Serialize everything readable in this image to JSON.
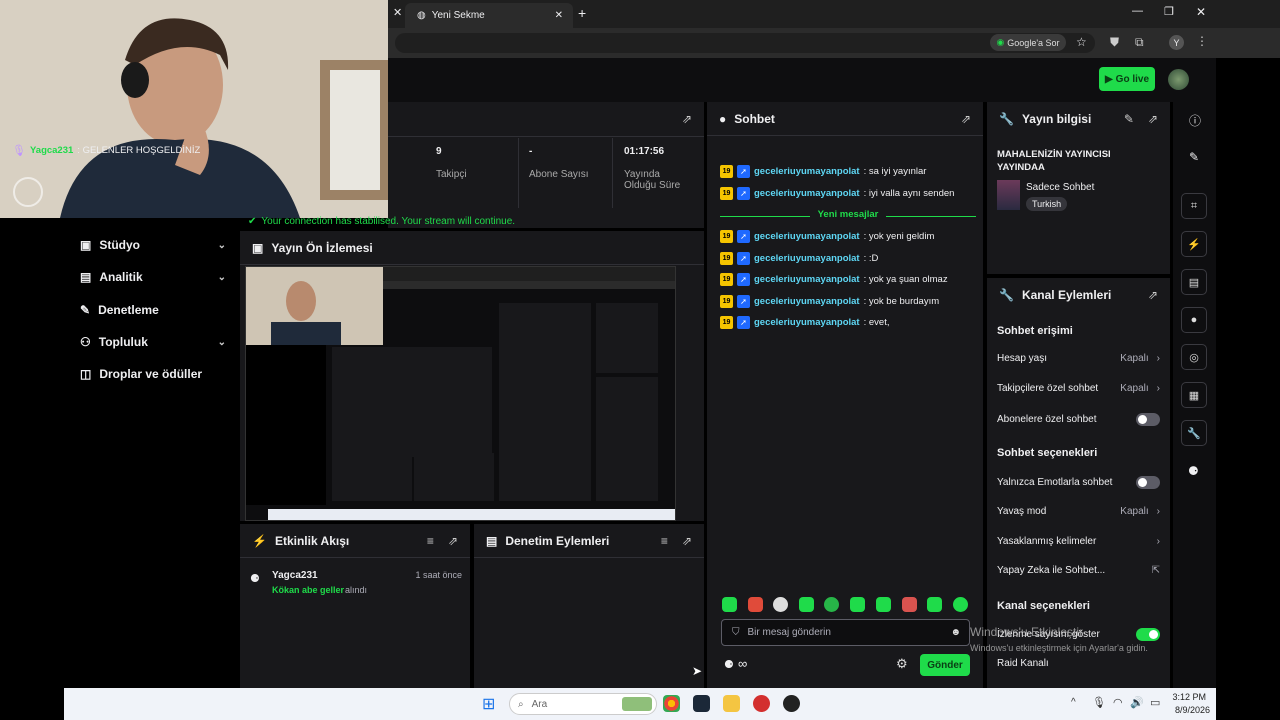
{
  "browser": {
    "tab_title": "Yeni Sekme",
    "ask_google": "Google'a Sor",
    "profile_initial": "Y"
  },
  "topnav": {
    "go_live": "Go live"
  },
  "connection_notice": "Your connection has stabilised. Your stream will continue.",
  "left_nav": {
    "items": [
      {
        "label": "Stüdyo",
        "has_chevron": true,
        "icon": "video-icon"
      },
      {
        "label": "Analitik",
        "has_chevron": true,
        "icon": "chart-icon"
      },
      {
        "label": "Denetleme",
        "has_chevron": false,
        "icon": "wrench-icon"
      },
      {
        "label": "Topluluk",
        "has_chevron": true,
        "icon": "community-icon"
      },
      {
        "label": "Droplar ve ödüller",
        "has_chevron": false,
        "icon": "gift-icon"
      }
    ]
  },
  "stats": [
    {
      "value": "9",
      "label": "Takipçi"
    },
    {
      "value": "-",
      "label": "Abone Sayısı"
    },
    {
      "value": "01:17:56",
      "label": "Yayında Olduğu Süre"
    }
  ],
  "preview": {
    "title": "Yayın Ön İzlemesi"
  },
  "activity": {
    "title": "Etkinlik Akışı",
    "items": [
      {
        "user": "Yagca231",
        "time": "1 saat önce",
        "reward": "Kökan abe geller",
        "suffix": " alındı"
      }
    ]
  },
  "mod_actions": {
    "title": "Denetim Eylemleri"
  },
  "chat": {
    "title": "Sohbet",
    "pinned": {
      "user": "Yagca231",
      "text": ": GELENLER HOŞGELDİNİZ"
    },
    "messages_before": [
      {
        "badge": "19",
        "user": "geceleriuyumayanpolat",
        "text": ": sa iyi yayınlar"
      },
      {
        "badge": "19",
        "user": "geceleriuyumayanpolat",
        "text": ": iyi valla aynı senden"
      }
    ],
    "new_messages_label": "Yeni mesajlar",
    "messages_after": [
      {
        "badge": "19",
        "user": "geceleriuyumayanpolat",
        "text": ": yok yeni geldim"
      },
      {
        "badge": "19",
        "user": "geceleriuyumayanpolat",
        "text": ": :D"
      },
      {
        "badge": "19",
        "user": "geceleriuyumayanpolat",
        "text": ": yok ya şuan olmaz"
      },
      {
        "badge": "19",
        "user": "geceleriuyumayanpolat",
        "text": ": yok be burdayım"
      },
      {
        "badge": "19",
        "user": "geceleriuyumayanpolat",
        "text": ": evet,"
      }
    ],
    "input_placeholder": "Bir mesaj gönderin",
    "send_label": "Gönder",
    "infinity": "∞"
  },
  "stream_info": {
    "title": "Yayın bilgisi",
    "stream_title": "MAHALENİZİN YAYINCISI YAYINDAA",
    "category": "Sadece Sohbet",
    "tag": "Turkish"
  },
  "channel_actions": {
    "title": "Kanal Eylemleri",
    "chat_access": "Sohbet erişimi",
    "account_age": "Hesap yaşı",
    "account_age_val": "Kapalı",
    "followers_only": "Takipçilere özel sohbet",
    "followers_only_val": "Kapalı",
    "subs_only": "Abonelere özel sohbet",
    "chat_options": "Sohbet seçenekleri",
    "emotes_only": "Yalnızca Emotlarla sohbet",
    "slow_mode": "Yavaş mod",
    "slow_mode_val": "Kapalı",
    "banned_words": "Yasaklanmış kelimeler",
    "ai_chat": "Yapay Zeka ile Sohbet...",
    "channel_options": "Kanal seçenekleri",
    "show_viewers": "İzlenme sayısını göster",
    "raid": "Raid Kanalı"
  },
  "watermark": {
    "line1": "Windows'u Etkinleştir",
    "line2": "Windows'u etkinleştirmek için Ayarlar'a gidin."
  },
  "taskbar": {
    "search_placeholder": "Ara",
    "time": "3:12 PM",
    "date": "8/9/2026"
  }
}
